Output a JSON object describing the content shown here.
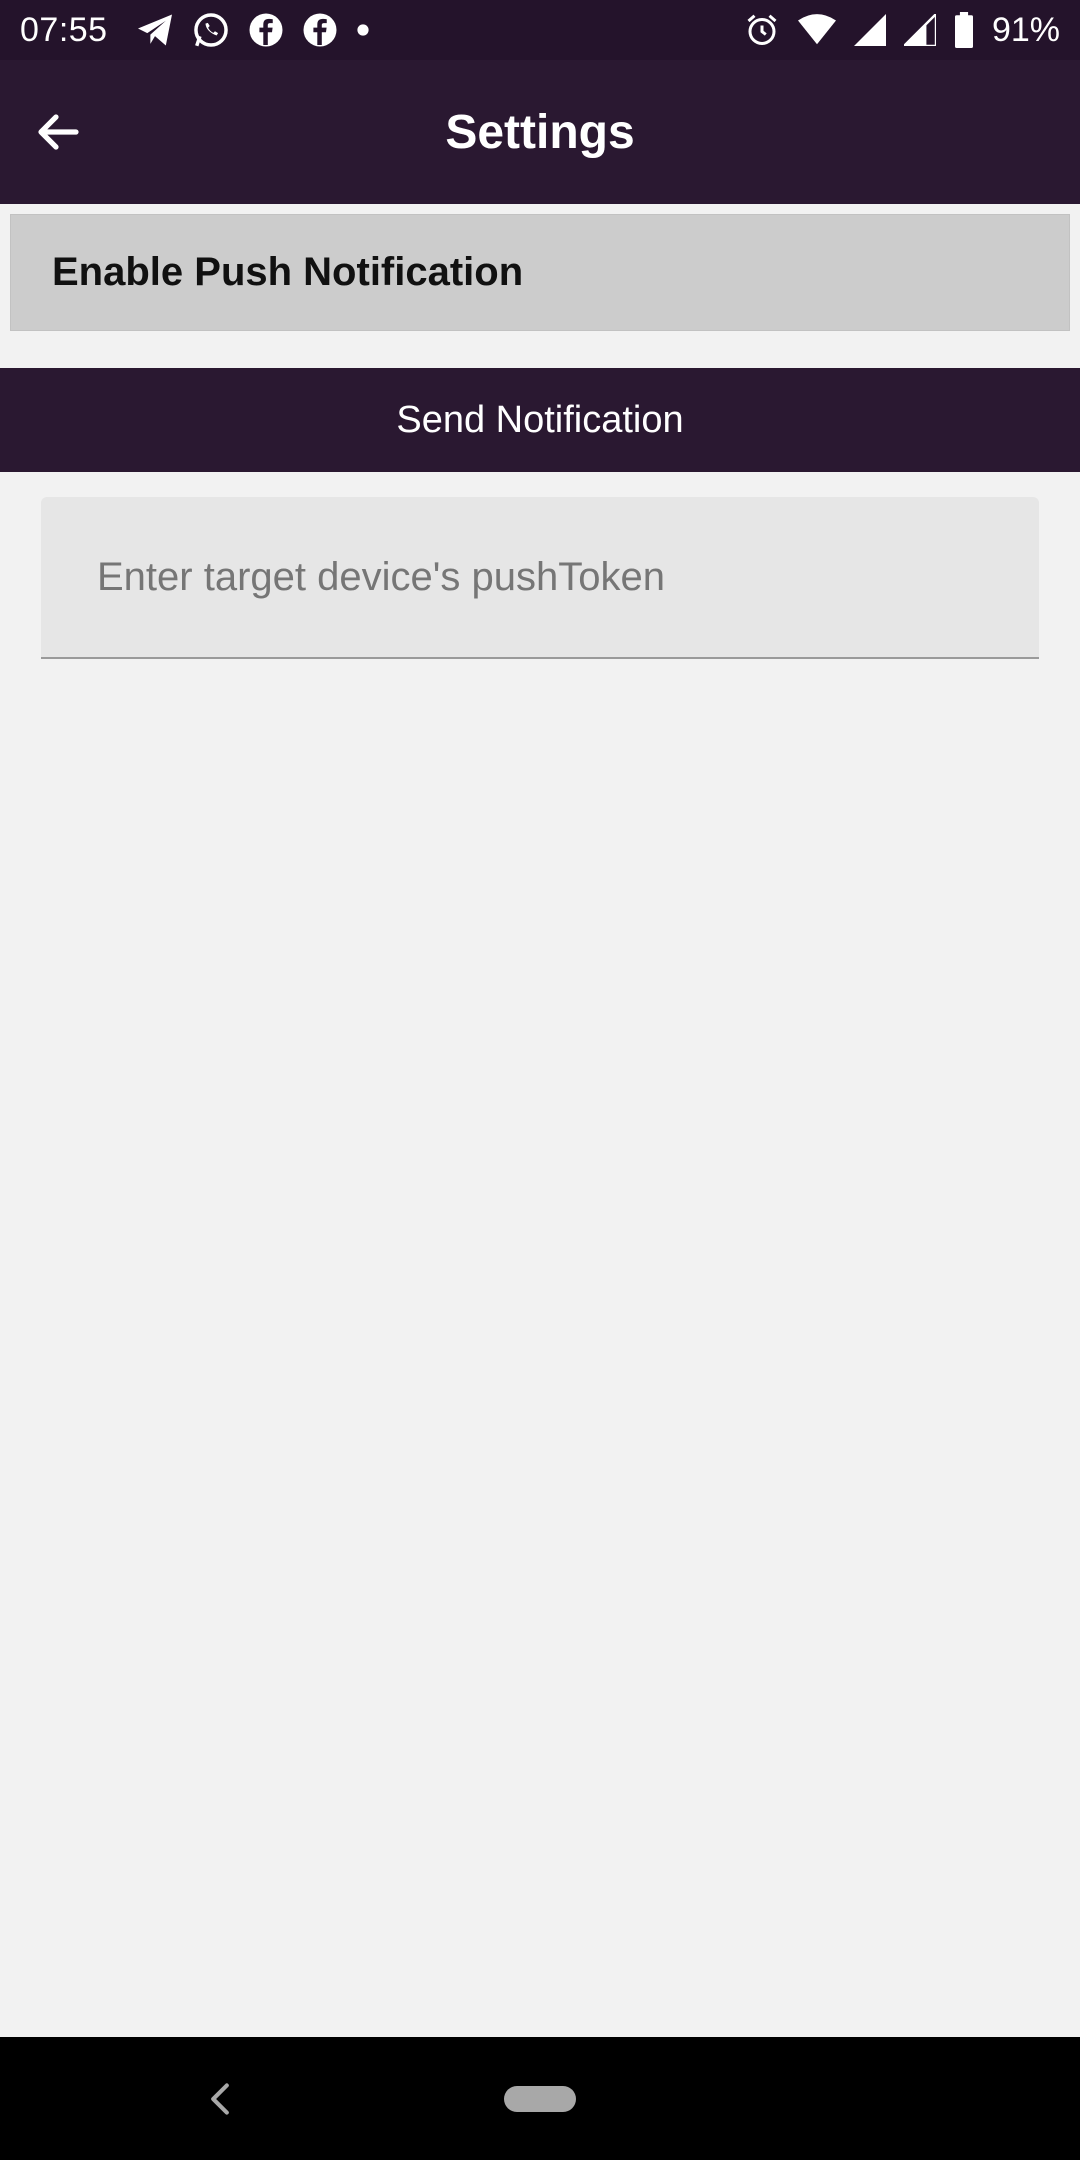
{
  "status_bar": {
    "time": "07:55",
    "battery_percent": "91%",
    "left_icons": [
      "telegram-icon",
      "whatsapp-icon",
      "facebook-icon",
      "facebook-icon",
      "dot-icon"
    ],
    "right_icons": [
      "alarm-icon",
      "wifi-icon",
      "signal-icon",
      "signal-icon",
      "battery-icon"
    ]
  },
  "app_bar": {
    "title": "Settings",
    "back_icon": "arrow-left-icon"
  },
  "settings": {
    "enable_push_label": "Enable Push Notification"
  },
  "actions": {
    "send_notification_label": "Send Notification"
  },
  "push_token_field": {
    "placeholder": "Enter target device's pushToken",
    "value": ""
  },
  "colors": {
    "primary": "#2a1831",
    "status_bar": "#24132b",
    "background": "#f2f2f2",
    "row_background": "#cccccc"
  }
}
